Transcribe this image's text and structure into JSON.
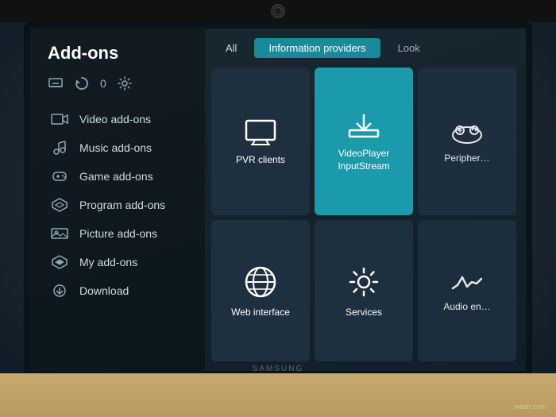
{
  "page": {
    "title": "Add-ons"
  },
  "sidebar": {
    "title": "Add-ons",
    "icons": {
      "install_label": "Install",
      "refresh_label": "Refresh",
      "count_label": "0",
      "settings_label": "Settings"
    },
    "items": [
      {
        "id": "video",
        "label": "Video add-ons",
        "icon": "video"
      },
      {
        "id": "music",
        "label": "Music add-ons",
        "icon": "music"
      },
      {
        "id": "game",
        "label": "Game add-ons",
        "icon": "game"
      },
      {
        "id": "program",
        "label": "Program add-ons",
        "icon": "program"
      },
      {
        "id": "picture",
        "label": "Picture add-ons",
        "icon": "picture"
      },
      {
        "id": "my",
        "label": "My add-ons",
        "icon": "myaddon"
      },
      {
        "id": "download",
        "label": "Download",
        "icon": "download"
      }
    ]
  },
  "filter_tabs": [
    {
      "id": "all",
      "label": "All",
      "active": false
    },
    {
      "id": "info",
      "label": "Information providers",
      "active": true
    },
    {
      "id": "look",
      "label": "Look",
      "active": false
    }
  ],
  "addon_tiles": [
    {
      "id": "pvr",
      "label": "PVR clients",
      "icon": "tv",
      "highlighted": false
    },
    {
      "id": "videoplayer",
      "label": "VideoPlayer\nInputStream",
      "icon": "download-tray",
      "highlighted": true
    },
    {
      "id": "peripheral",
      "label": "Peripher…",
      "icon": "gamepad-partial",
      "highlighted": false,
      "partial": true
    },
    {
      "id": "web",
      "label": "Web interface",
      "icon": "globe",
      "highlighted": false
    },
    {
      "id": "services",
      "label": "Services",
      "icon": "gear",
      "highlighted": false
    },
    {
      "id": "audio",
      "label": "Audio en…",
      "icon": "audio-partial",
      "highlighted": false,
      "partial": true
    }
  ],
  "watermark": "wsdn.com"
}
